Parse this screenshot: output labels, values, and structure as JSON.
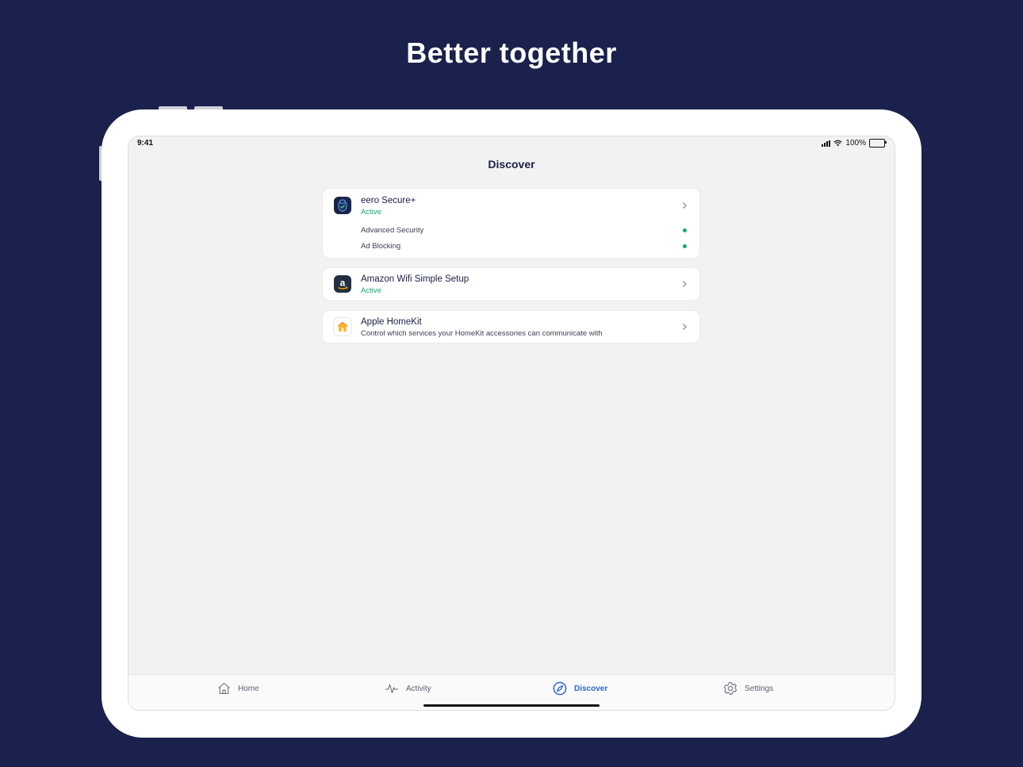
{
  "headline": "Better together",
  "statusbar": {
    "time": "9:41",
    "battery_text": "100%"
  },
  "page_title": "Discover",
  "cards": [
    {
      "title": "eero Secure+",
      "subtitle": "Active",
      "icon": "eero-secure-shield-icon",
      "features": [
        {
          "label": "Advanced Security",
          "status": "enabled"
        },
        {
          "label": "Ad Blocking",
          "status": "enabled"
        }
      ]
    },
    {
      "title": "Amazon Wifi Simple Setup",
      "subtitle": "Active",
      "icon": "amazon-logo-icon"
    },
    {
      "title": "Apple HomeKit",
      "subtitle": "Control which services your HomeKit accessories can communicate with",
      "icon": "homekit-house-icon"
    }
  ],
  "tabs": [
    {
      "label": "Home",
      "icon": "home-icon",
      "active": false
    },
    {
      "label": "Activity",
      "icon": "activity-pulse-icon",
      "active": false
    },
    {
      "label": "Discover",
      "icon": "compass-icon",
      "active": true
    },
    {
      "label": "Settings",
      "icon": "gear-icon",
      "active": false
    }
  ],
  "colors": {
    "background": "#19214c",
    "active_green": "#13a87d",
    "tab_active_blue": "#2c68d6",
    "title_navy": "#1a1f45"
  }
}
